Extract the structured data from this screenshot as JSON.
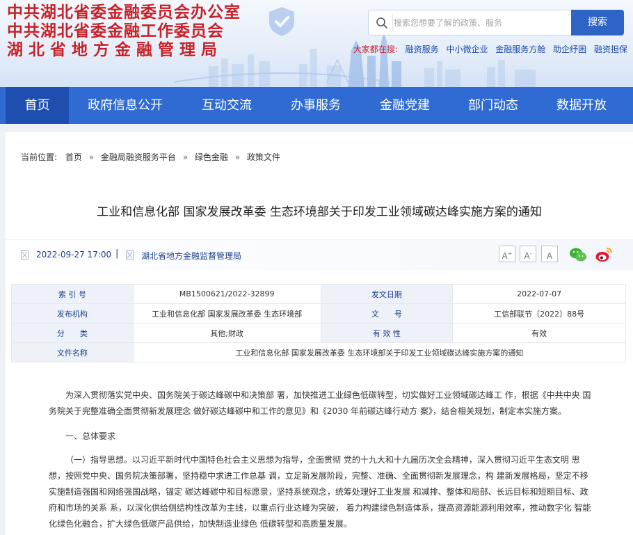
{
  "header": {
    "org_lines": [
      "中共湖北省委金融委员会办公室",
      "中共湖北省委金融工作委员会",
      "湖北省地方金融管理局"
    ],
    "search": {
      "placeholder": "搜索您想要了解的政策、服务",
      "button_label": "搜索"
    },
    "hot": {
      "label": "大家都在搜:",
      "links": [
        "融资服务",
        "中小微企业",
        "金融服务方舱",
        "助企纾困",
        "融资担保"
      ]
    }
  },
  "nav": {
    "items": [
      "首页",
      "政府信息公开",
      "互动交流",
      "办事服务",
      "金融党建",
      "部门动态",
      "数据开放"
    ],
    "active_index": 0
  },
  "breadcrumb": {
    "label": "当前位置:",
    "items": [
      "首页",
      "金融局融资服务平台",
      "绿色金融",
      "政策文件"
    ]
  },
  "article": {
    "title": "工业和信息化部 国家发展改革委 生态环境部关于印发工业领域碳达峰实施方案的通知",
    "datetime": "2022-09-27 17:00",
    "separator": "|",
    "source": "湖北省地方金融监督管理局",
    "font_buttons": [
      "A",
      "A",
      "A"
    ],
    "font_button_marks": [
      "+",
      "-",
      ""
    ]
  },
  "info_table": {
    "rows": [
      [
        "索 引 号",
        "MB1500621/2022-32899",
        "发文日期",
        "2022-07-07"
      ],
      [
        "发布机构",
        "工业和信息化部 国家发展改革委 生态环境部",
        "文　　号",
        "工信部联节〔2022〕88号"
      ],
      [
        "分　　类",
        "其他;财政",
        "有 效 性",
        "有效"
      ],
      [
        "文件名称",
        "工业和信息化部 国家发展改革委 生态环境部关于印发工业领域碳达峰实施方案的通知"
      ]
    ]
  },
  "body": {
    "paragraphs": [
      "为深入贯彻落实党中央、国务院关于碳达峰碳中和决策部 署，加快推进工业绿色低碳转型，切实做好工业领域碳达峰工 作，根据《中共中央 国务院关于完整准确全面贯彻新发展理念 做好碳达峰碳中和工作的意见》和《2030 年前碳达峰行动方 案》，结合相关规划，制定本实施方案。",
      "一、总体要求",
      "（一）指导思想。以习近平新时代中国特色社会主义思想为指导，全面贯彻 党的十九大和十九届历次全会精神，深入贯彻习近平生态文明 思想，按照党中央、国务院决策部署，坚持稳中求进工作总基 调，立足新发展阶段，完整、准确、全面贯彻新发展理念，构 建新发展格局，坚定不移实施制造强国和网络强国战略，锚定 碳达峰碳中和目标愿景，坚持系统观念，统筹处理好工业发展 和减排、整体和局部、长远目标和短期目标、政府和市场的关系 系，以深化供给侧结构性改革为主线，以重点行业达峰为突破， 着力构建绿色制造体系，提高资源能源利用效率，推动数字化 智能化绿色化融合，扩大绿色低碳产品供给，加快制造业绿色 低碳转型和高质量发展。"
    ]
  }
}
